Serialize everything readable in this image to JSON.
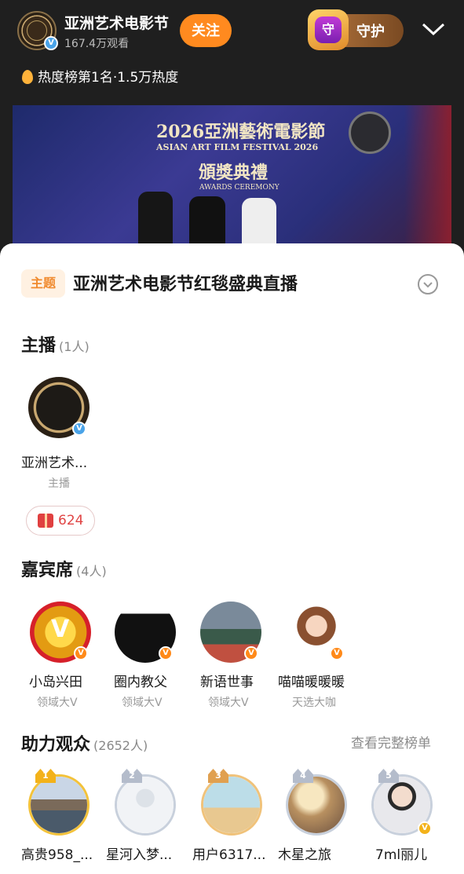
{
  "header": {
    "host_name": "亚洲艺术电影节",
    "viewers": "167.4万观看",
    "follow_label": "关注",
    "guard_label": "守护",
    "guard_glyph": "守",
    "hot_text": "热度榜第1名·1.5万热度"
  },
  "video": {
    "title_cn": "2026亞洲藝術電影節",
    "title_en": "ASIAN ART FILM FESTIVAL 2026",
    "ceremony_cn": "頒獎典禮",
    "ceremony_en": "AWARDS CEREMONY"
  },
  "theme": {
    "tag": "主题",
    "title": "亚洲艺术电影节红毯盛典直播"
  },
  "anchors": {
    "heading": "主播",
    "count": "(1人)",
    "items": [
      {
        "name": "亚洲艺术...",
        "role": "主播"
      }
    ],
    "gift_count": "624"
  },
  "guests": {
    "heading": "嘉宾席",
    "count": "(4人)",
    "items": [
      {
        "name": "小岛兴田",
        "tag": "领域大V"
      },
      {
        "name": "圈内教父",
        "tag": "领域大V"
      },
      {
        "name": "新语世事",
        "tag": "领域大V"
      },
      {
        "name": "喵喵暖暖暖",
        "tag": "天选大咖"
      }
    ]
  },
  "audience": {
    "heading": "助力观众",
    "count": "(2652人)",
    "view_all": "查看完整榜单",
    "items": [
      {
        "rank": "1",
        "name": "高贵958_..."
      },
      {
        "rank": "2",
        "name": "星河入梦..."
      },
      {
        "rank": "3",
        "name": "用户6317..."
      },
      {
        "rank": "4",
        "name": "木星之旅"
      },
      {
        "rank": "5",
        "name": "7ml丽儿"
      }
    ]
  },
  "colors": {
    "accent": "#ff8a1f",
    "verified_blue": "#4aa3e8",
    "verified_orange": "#ff8a1a"
  }
}
